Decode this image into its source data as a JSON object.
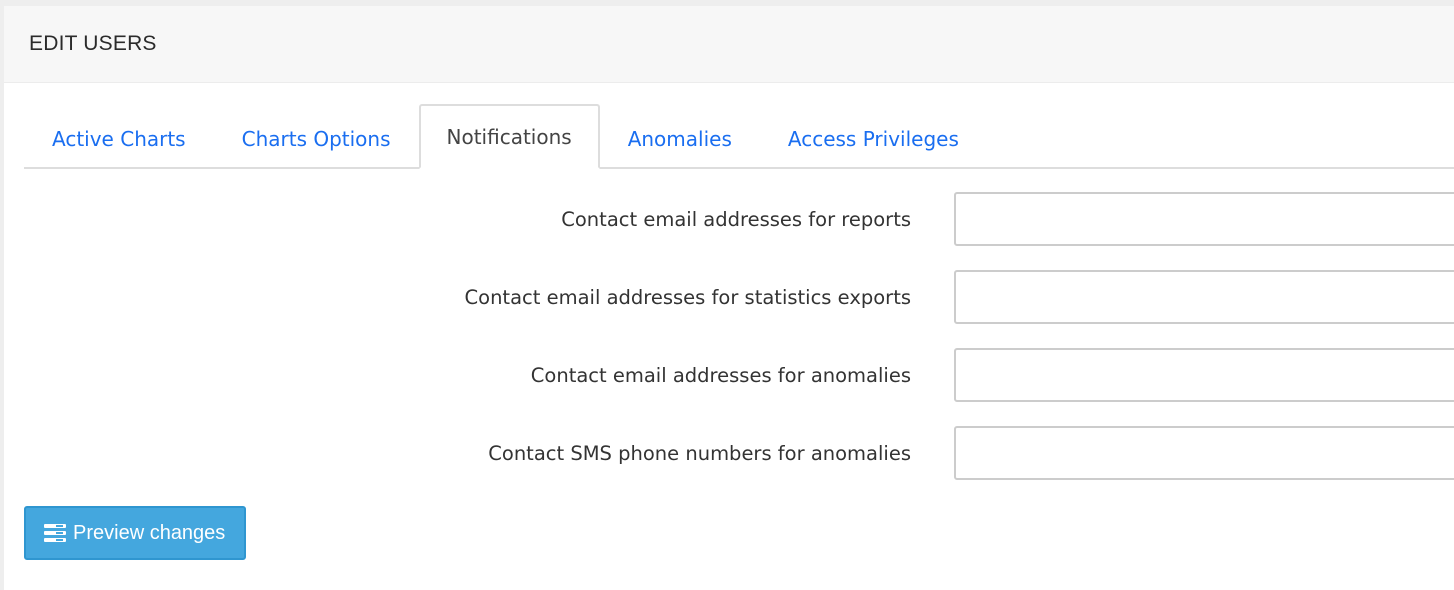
{
  "panel": {
    "title": "EDIT USERS"
  },
  "tabs": [
    {
      "label": "Active Charts",
      "active": false
    },
    {
      "label": "Charts Options",
      "active": false
    },
    {
      "label": "Notifications",
      "active": true
    },
    {
      "label": "Anomalies",
      "active": false
    },
    {
      "label": "Access Privileges",
      "active": false
    }
  ],
  "form": {
    "fields": [
      {
        "label": "Contact email addresses for reports",
        "value": ""
      },
      {
        "label": "Contact email addresses for statistics exports",
        "value": ""
      },
      {
        "label": "Contact email addresses for anomalies",
        "value": ""
      },
      {
        "label": "Contact SMS phone numbers for anomalies",
        "value": ""
      }
    ]
  },
  "actions": {
    "preview_label": "Preview changes",
    "preview_icon": "list-icon"
  },
  "colors": {
    "link": "#1a6ef0",
    "primary_button": "#44a7de"
  }
}
